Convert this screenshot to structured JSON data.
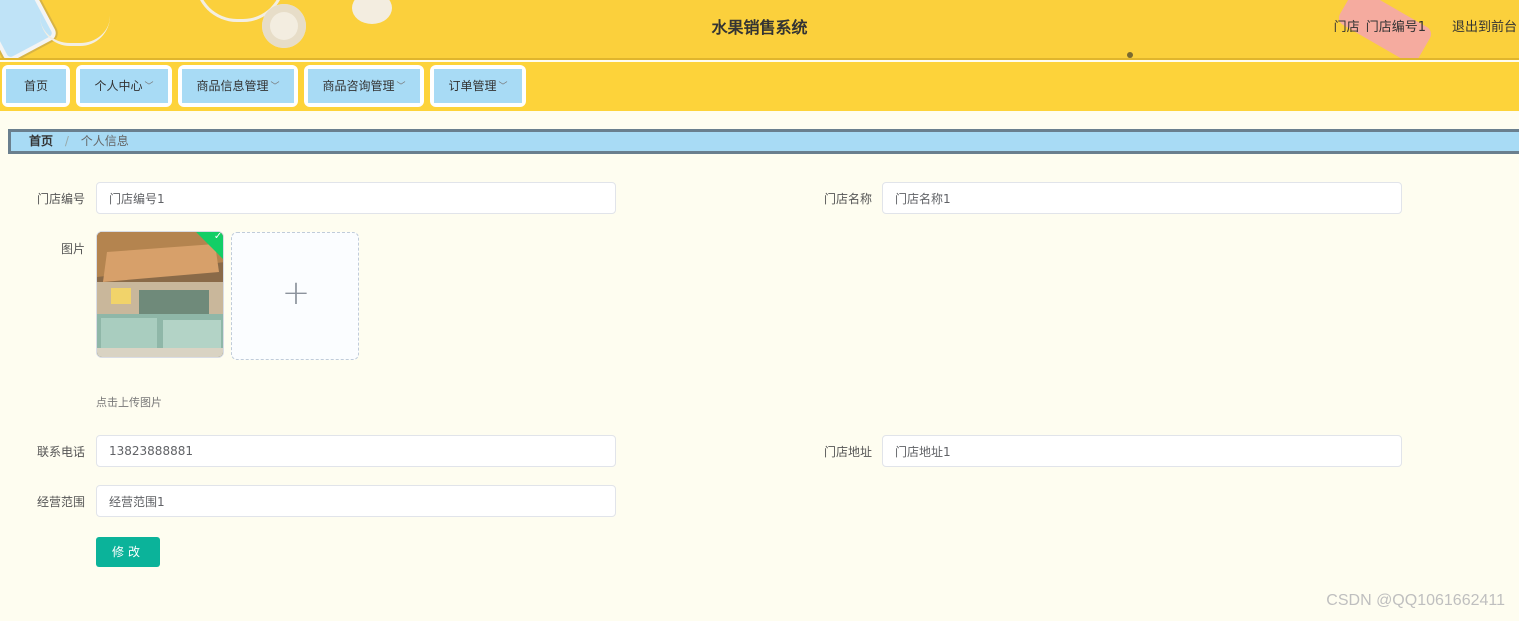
{
  "header": {
    "title": "水果销售系统",
    "role": "门店",
    "username": "门店编号1",
    "back_link": "退出到前台"
  },
  "nav": {
    "items": [
      {
        "label": "首页",
        "has_dropdown": false
      },
      {
        "label": "个人中心",
        "has_dropdown": true
      },
      {
        "label": "商品信息管理",
        "has_dropdown": true
      },
      {
        "label": "商品咨询管理",
        "has_dropdown": true
      },
      {
        "label": "订单管理",
        "has_dropdown": true
      }
    ]
  },
  "breadcrumb": {
    "home": "首页",
    "separator": "/",
    "current": "个人信息"
  },
  "form": {
    "store_no": {
      "label": "门店编号",
      "value": "门店编号1"
    },
    "store_name": {
      "label": "门店名称",
      "value": "门店名称1"
    },
    "picture": {
      "label": "图片",
      "tip": "点击上传图片",
      "check": "✓",
      "plus": "+"
    },
    "phone": {
      "label": "联系电话",
      "value": "13823888881"
    },
    "address": {
      "label": "门店地址",
      "value": "门店地址1"
    },
    "scope": {
      "label": "经营范围",
      "value": "经营范围1"
    },
    "submit_label": "修改"
  },
  "watermark": "CSDN @QQ1061662411",
  "colors": {
    "header_bg": "#fbd03c",
    "nav_item_bg": "#a8dbf5",
    "page_bg": "#fefdf0",
    "button": "#0bb39a"
  }
}
